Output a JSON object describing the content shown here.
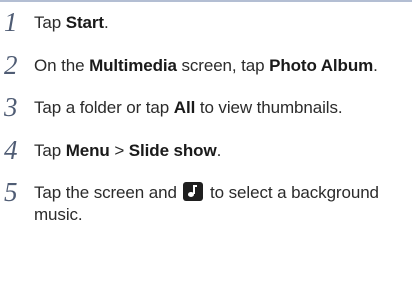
{
  "steps": [
    {
      "number": "1",
      "text": {
        "a": "Tap ",
        "b": "Start",
        "c": "."
      }
    },
    {
      "number": "2",
      "text": {
        "a": "On the ",
        "b": "Multimedia",
        "c": " screen, tap ",
        "d": "Photo Album",
        "e": "."
      }
    },
    {
      "number": "3",
      "text": {
        "a": "Tap a folder or tap ",
        "b": "All",
        "c": " to view thumbnails."
      }
    },
    {
      "number": "4",
      "text": {
        "a": "Tap ",
        "b": "Menu",
        "c": " > ",
        "d": "Slide show",
        "e": "."
      }
    },
    {
      "number": "5",
      "text": {
        "a": "Tap the screen and ",
        "icon": "music-note-icon",
        "b": " to select a background music."
      }
    }
  ]
}
